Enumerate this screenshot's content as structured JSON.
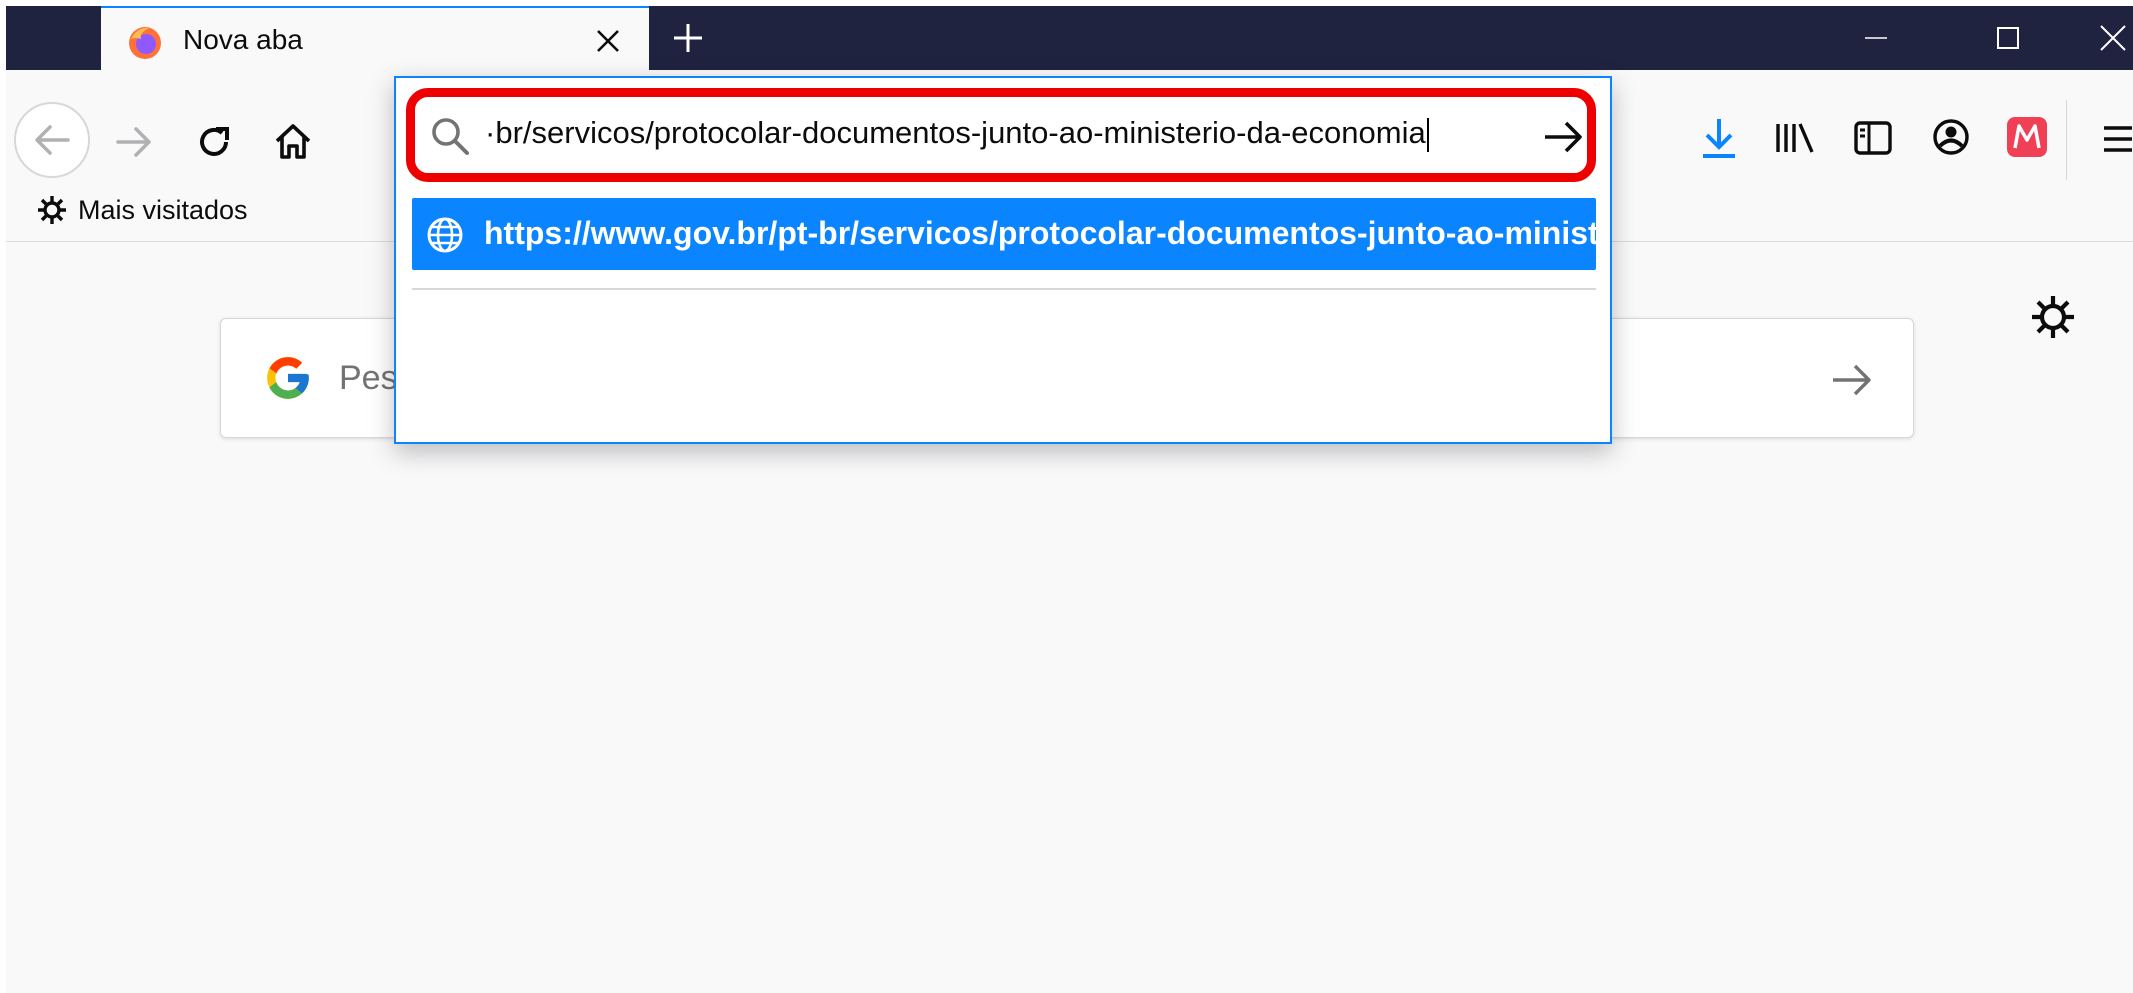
{
  "tab": {
    "title": "Nova aba"
  },
  "bookmarks": {
    "most_visited": "Mais visitados"
  },
  "newtab": {
    "search_placeholder": "Pesquisar na web"
  },
  "urlbar": {
    "typed_text": "·br/servicos/protocolar-documentos-junto-ao-ministerio-da-economia",
    "suggestion": "https://www.gov.br/pt-br/servicos/protocolar-documentos-junto-ao-ministerio-da-economia"
  },
  "colors": {
    "tabbar": "#202340",
    "accent": "#0a84ff",
    "highlight_box": "#ee0000",
    "pocket": "#ef4056"
  },
  "icons": [
    "firefox-logo-icon",
    "close-icon",
    "plus-icon",
    "minimize-icon",
    "maximize-icon",
    "back-icon",
    "forward-icon",
    "reload-icon",
    "home-icon",
    "search-icon",
    "arrow-right-icon",
    "globe-icon",
    "download-icon",
    "library-icon",
    "sidebar-icon",
    "account-icon",
    "extension-icon",
    "menu-icon",
    "gear-icon",
    "google-logo-icon"
  ]
}
